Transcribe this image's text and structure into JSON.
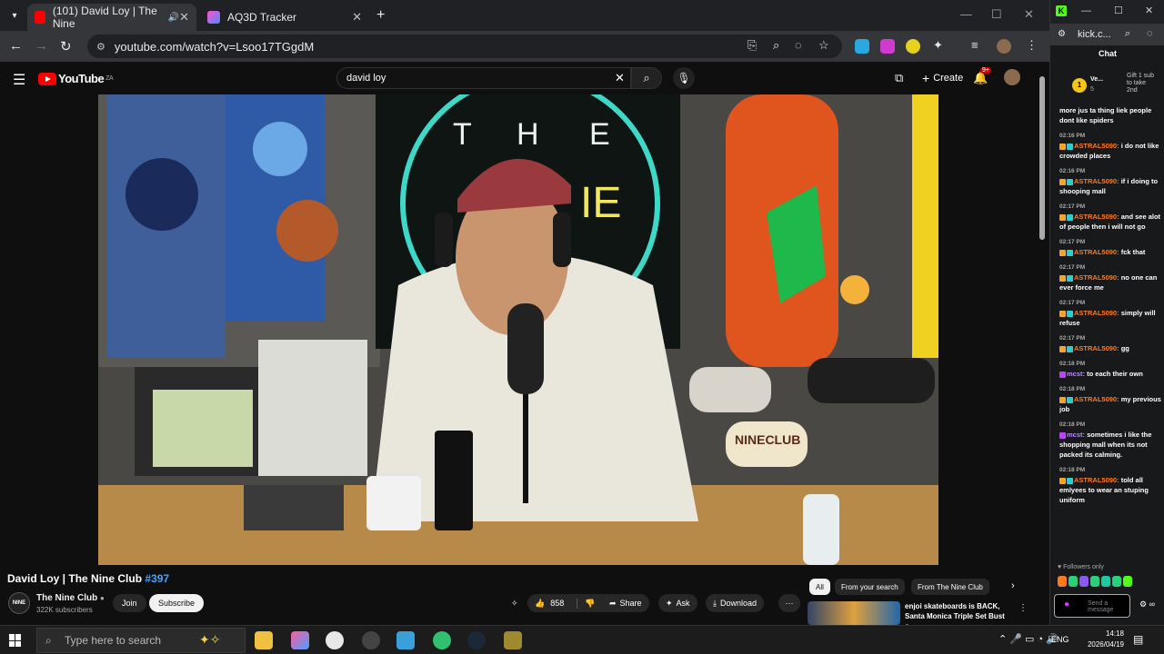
{
  "browser": {
    "tabs": [
      {
        "title": "(101) David Loy | The Nine",
        "favicon_color": "#ff0000"
      },
      {
        "title": "AQ3D Tracker",
        "favicon_color": "#b04fff"
      }
    ],
    "url": "youtube.com/watch?v=Lsoo17TGgdM"
  },
  "youtube": {
    "logo": "YouTube",
    "region": "ZA",
    "search_value": "david loy",
    "create_label": "Create",
    "notif_count": "9+",
    "video": {
      "title": "David Loy | The Nine Club",
      "tag": "#397",
      "channel": "The Nine Club",
      "channel_avatar": "NINE",
      "subscribers": "322K subscribers",
      "join": "Join",
      "subscribe": "Subscribe",
      "likes": "858",
      "share": "Share",
      "ask": "Ask",
      "download": "Download"
    },
    "chips": [
      "All",
      "From your search",
      "From The Nine Club"
    ],
    "recommended": {
      "title": "enjoi skateboards is BACK, Santa Monica Triple Set Bust o..."
    }
  },
  "kick": {
    "url": "kick.c...",
    "chat_header": "Chat",
    "pinned": {
      "user": "Ve...",
      "count": "5",
      "text": "Gift 1 sub to take 2nd",
      "coin": "1"
    },
    "messages": [
      {
        "time": "",
        "user": "",
        "text": "more jus ta thing liek people dont like spiders"
      },
      {
        "time": "02:16 PM",
        "user": "ASTRAL5090:",
        "text": "i do not like crowded places"
      },
      {
        "time": "02:16 PM",
        "user": "ASTRAL5090:",
        "text": "if i doing to shooping mall"
      },
      {
        "time": "02:17 PM",
        "user": "ASTRAL5090:",
        "text": "and see alot of people then i will not go"
      },
      {
        "time": "02:17 PM",
        "user": "ASTRAL5090:",
        "text": "fck that"
      },
      {
        "time": "02:17 PM",
        "user": "ASTRAL5090:",
        "text": "no one can ever force me"
      },
      {
        "time": "02:17 PM",
        "user": "ASTRAL5090:",
        "text": "simply will refuse"
      },
      {
        "time": "02:17 PM",
        "user": "ASTRAL5090:",
        "text": "gg"
      },
      {
        "time": "02:18 PM",
        "user2": "mcst:",
        "text": "to each their own"
      },
      {
        "time": "02:18 PM",
        "user": "ASTRAL5090:",
        "text": "my previous job"
      },
      {
        "time": "02:18 PM",
        "user2": "mcst:",
        "text": "sometimes i like the shopping mall when its not packed its calming."
      },
      {
        "time": "02:18 PM",
        "user": "ASTRAL5090:",
        "text": "told all emlyees to wear an stuping uniform"
      }
    ],
    "followers_only": "Followers only",
    "input_placeholder": "Send a message"
  },
  "taskbar": {
    "search_placeholder": "Type here to search",
    "lang": "ENG",
    "time": "14:18",
    "date": "2026/04/19"
  }
}
